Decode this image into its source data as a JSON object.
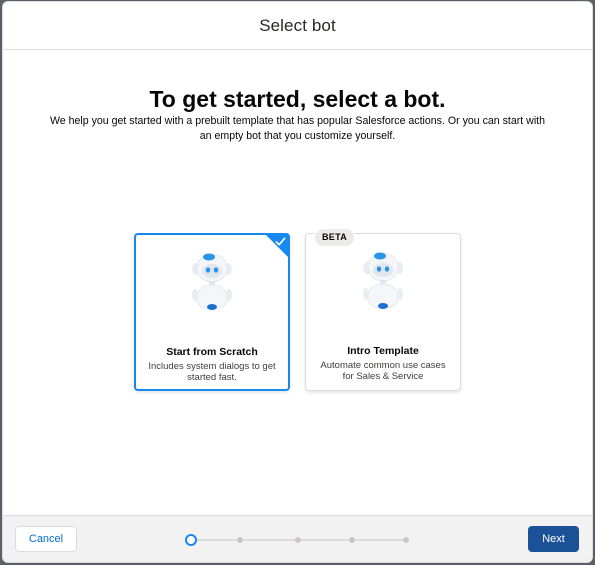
{
  "modal": {
    "title": "Select bot"
  },
  "intro": {
    "headline": "To get started, select a bot.",
    "description": "We help you get started with a prebuilt template that has popular Salesforce actions. Or you can start with an empty bot that you customize yourself."
  },
  "cards": [
    {
      "title": "Start from Scratch",
      "description": "Includes system dialogs to get started fast.",
      "selected": true,
      "icon": "bot-icon",
      "badge": ""
    },
    {
      "title": "Intro Template",
      "description": "Automate common use cases for Sales & Service",
      "selected": false,
      "icon": "bot-icon",
      "badge": "BETA"
    }
  ],
  "footer": {
    "cancel_label": "Cancel",
    "next_label": "Next",
    "progress": {
      "total_steps": 5,
      "current_step": 1
    }
  },
  "colors": {
    "brand": "#1589ee",
    "primary_button": "#1b5297",
    "link": "#0070d2"
  }
}
